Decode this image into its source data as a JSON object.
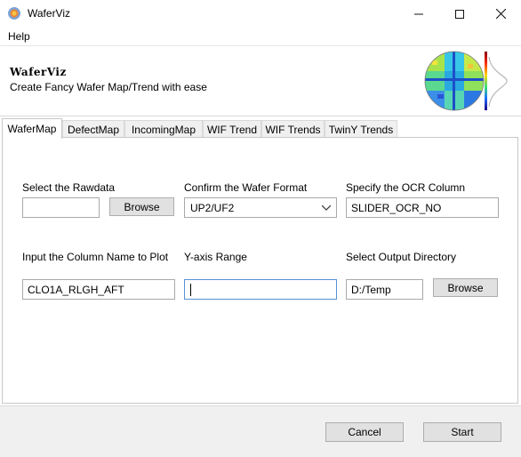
{
  "window": {
    "title": "WaferViz",
    "minimize_glyph": "—",
    "maximize_glyph": "☐",
    "close_glyph": "✕"
  },
  "menu": {
    "help": "Help"
  },
  "header": {
    "app_name": "WaferViz",
    "tagline": "Create Fancy Wafer Map/Trend with ease",
    "logo_icon": "wafer-map-logo-icon"
  },
  "tabs": [
    {
      "label": "WaferMap",
      "active": true
    },
    {
      "label": "DefectMap",
      "active": false
    },
    {
      "label": "IncomingMap",
      "active": false
    },
    {
      "label": "WIF Trend",
      "active": false
    },
    {
      "label": "WIF Trends",
      "active": false
    },
    {
      "label": "TwinY Trends",
      "active": false
    }
  ],
  "form": {
    "rawdata": {
      "label": "Select the Rawdata",
      "value": "",
      "browse": "Browse"
    },
    "wafer_format": {
      "label": "Confirm the Wafer Format",
      "value": "UP2/UF2"
    },
    "ocr_column": {
      "label": "Specify the OCR Column",
      "value": "SLIDER_OCR_NO"
    },
    "column_name": {
      "label": "Input the Column Name to Plot",
      "value": "CLO1A_RLGH_AFT"
    },
    "y_range": {
      "label": "Y-axis Range",
      "value": ""
    },
    "output_dir": {
      "label": "Select Output Directory",
      "value": "D:/Temp",
      "browse": "Browse"
    }
  },
  "footer": {
    "cancel": "Cancel",
    "start": "Start"
  }
}
